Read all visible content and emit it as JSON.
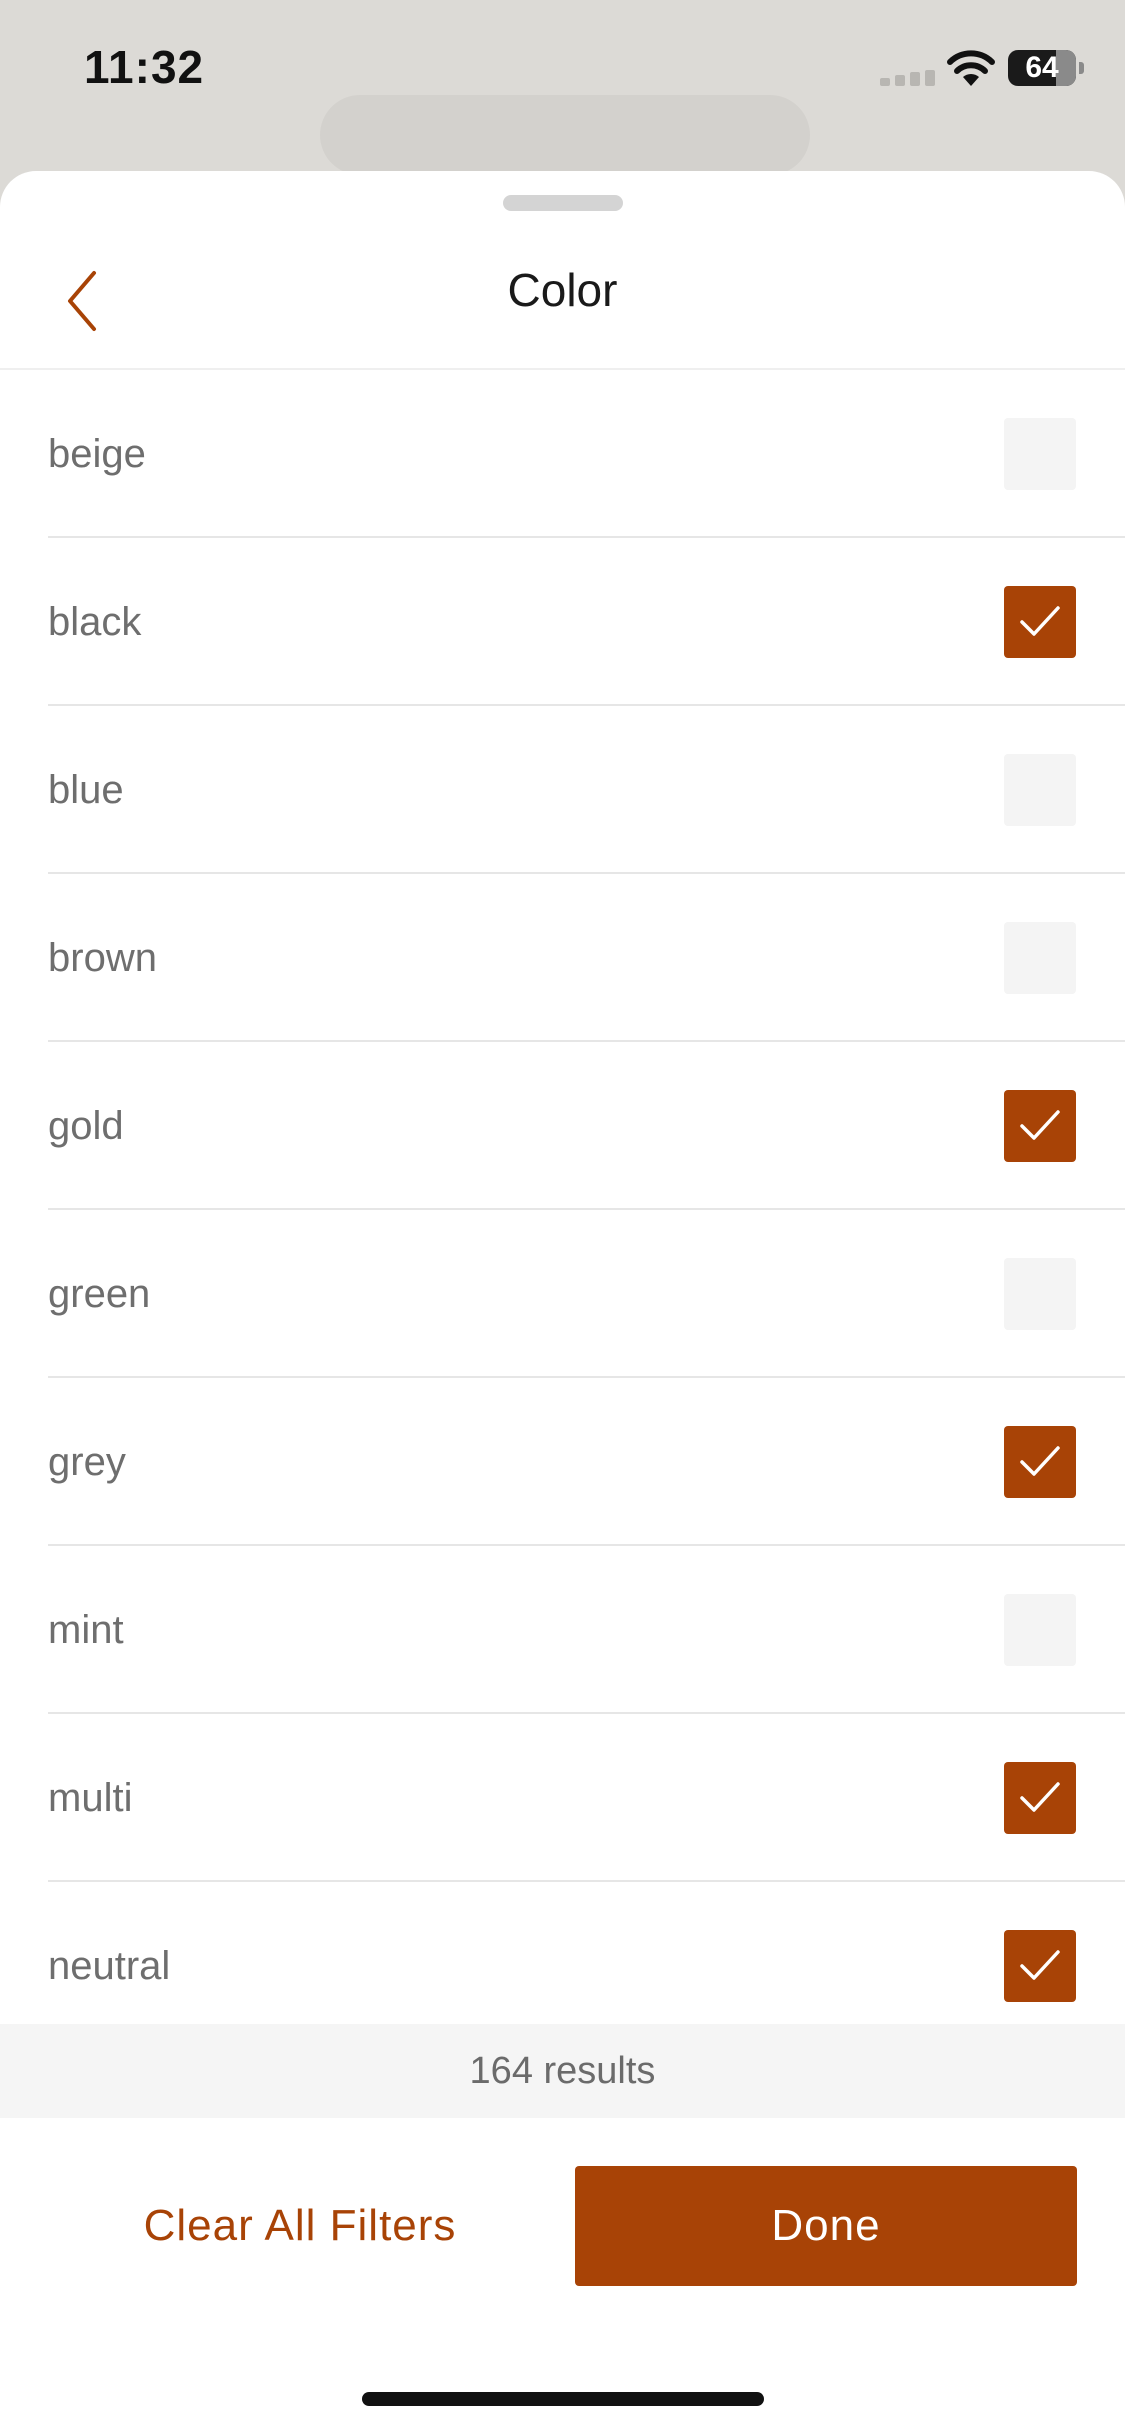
{
  "status_bar": {
    "time": "11:32",
    "battery_level": "64",
    "icons": [
      "cellular-signal-icon",
      "wifi-icon",
      "battery-icon"
    ]
  },
  "sheet": {
    "title": "Color",
    "back_icon": "chevron-left-icon"
  },
  "colors": {
    "accent": "#a84306",
    "unchecked_box": "#f4f4f4",
    "label_text": "#6e6e6e"
  },
  "options": [
    {
      "label": "beige",
      "checked": false
    },
    {
      "label": "black",
      "checked": true
    },
    {
      "label": "blue",
      "checked": false
    },
    {
      "label": "brown",
      "checked": false
    },
    {
      "label": "gold",
      "checked": true
    },
    {
      "label": "green",
      "checked": false
    },
    {
      "label": "grey",
      "checked": true
    },
    {
      "label": "mint",
      "checked": false
    },
    {
      "label": "multi",
      "checked": true
    },
    {
      "label": "neutral",
      "checked": true
    }
  ],
  "results": {
    "text": "164 results"
  },
  "footer": {
    "clear_label": "Clear All Filters",
    "done_label": "Done"
  }
}
